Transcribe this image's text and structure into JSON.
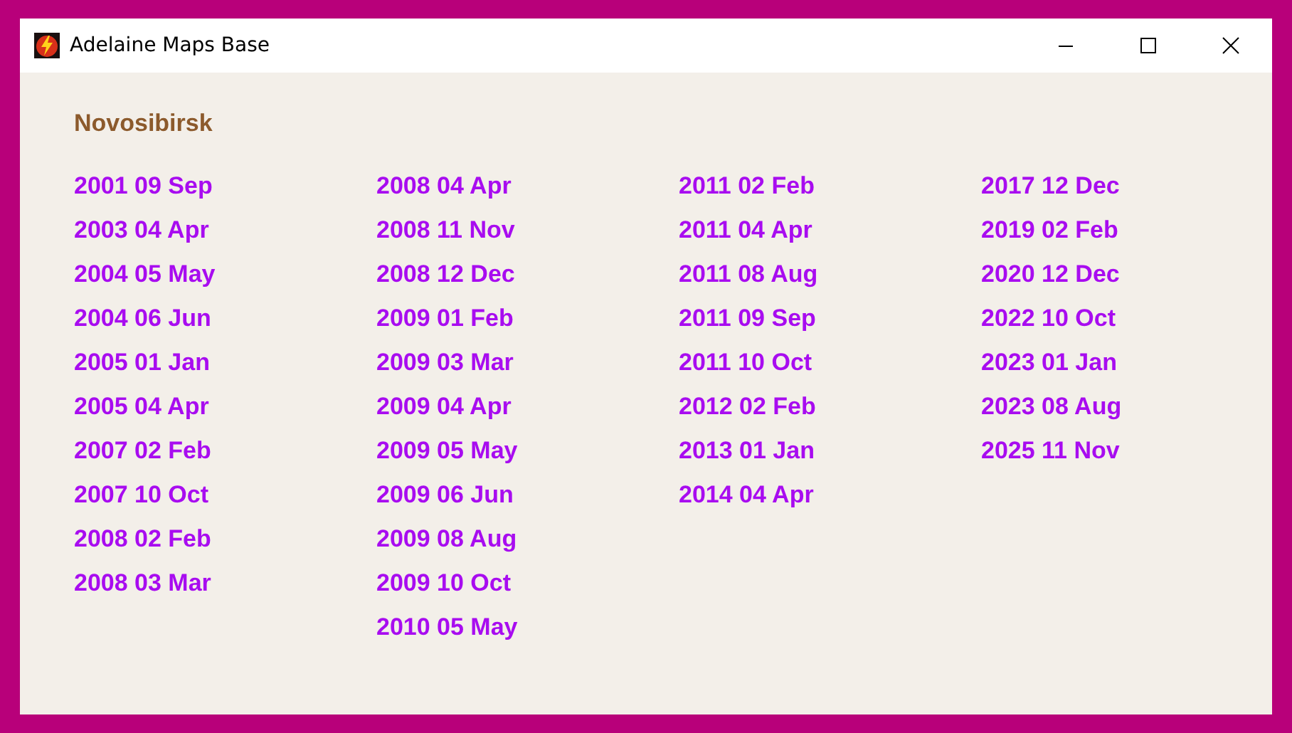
{
  "window": {
    "title": "Adelaine Maps Base"
  },
  "heading": "Novosibirsk",
  "columns": [
    [
      "2001 09 Sep",
      "2003 04 Apr",
      "2004 05 May",
      "2004 06 Jun",
      "2005 01 Jan",
      "2005 04 Apr",
      "2007 02 Feb",
      "2007 10 Oct",
      "2008 02 Feb",
      "2008 03 Mar"
    ],
    [
      "2008 04 Apr",
      "2008 11 Nov",
      "2008 12 Dec",
      "2009 01 Feb",
      "2009 03 Mar",
      "2009 04 Apr",
      "2009 05 May",
      "2009 06 Jun",
      "2009 08 Aug",
      "2009 10 Oct",
      "2010 05 May"
    ],
    [
      "2011 02 Feb",
      "2011 04 Apr",
      "2011 08 Aug",
      "2011 09 Sep",
      "2011 10 Oct",
      "2012 02 Feb",
      "2013 01 Jan",
      "2014 04 Apr"
    ],
    [
      "2017 12 Dec",
      "2019 02 Feb",
      "2020 12 Dec",
      "2022 10 Oct",
      "2023 01 Jan",
      "2023 08 Aug",
      "2025 11 Nov"
    ]
  ]
}
